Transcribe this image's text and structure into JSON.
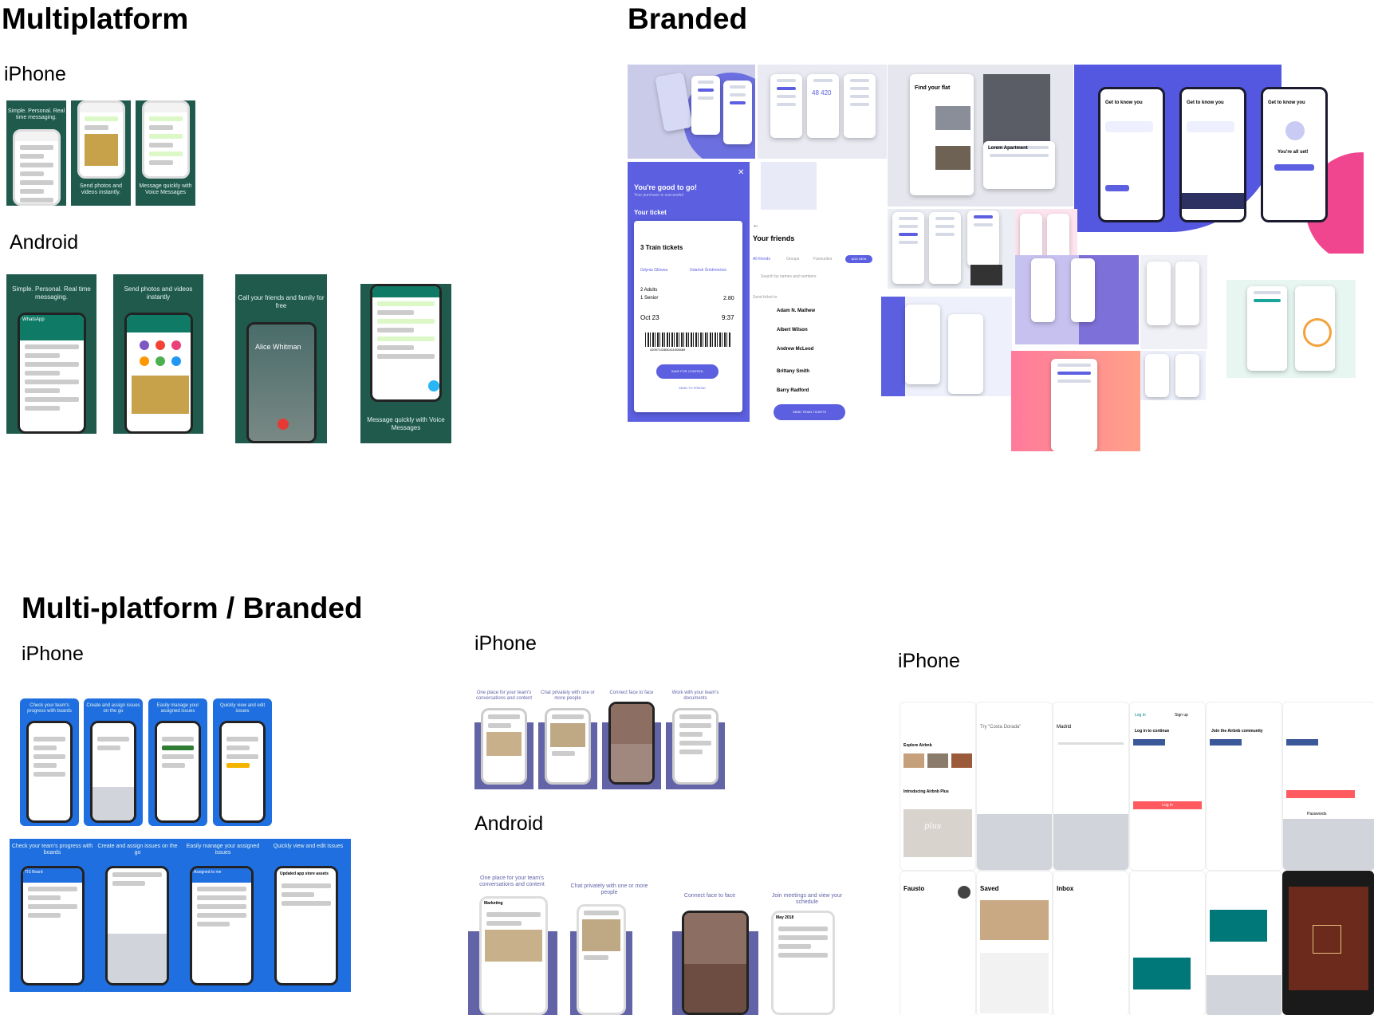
{
  "sections": {
    "multiplatform": {
      "title": "Multiplatform",
      "iphone_label": "iPhone",
      "android_label": "Android",
      "iphone_captions": [
        "Simple. Personal. Real time messaging.",
        "Send photos and videos instantly.",
        "Message quickly with Voice Messages"
      ],
      "android_captions": [
        "Simple. Personal. Real time messaging.",
        "Send photos and videos instantly",
        "Call your friends and family for free",
        "Message quickly with Voice Messages"
      ],
      "android_call_name": "Alice Whitman",
      "android_chat_header": "WhatsApp"
    },
    "branded": {
      "title": "Branded",
      "ticket": {
        "headline": "You're good to go!",
        "sub": "Your purchase is successful",
        "your_ticket": "Your ticket",
        "count": "3 Train tickets",
        "from": "Gdynia Główna",
        "to": "Gdańsk Śródmieście",
        "adults": "2 Adults",
        "senior": "1 Senior",
        "price": "2.80",
        "date": "Oct 23",
        "time": "9:37",
        "barcode_number": "42097132830411905689",
        "save_button": "SAVE FOR CONTROL",
        "send_link": "SEND TO FRIEND"
      },
      "friends": {
        "title": "Your friends",
        "tabs": [
          "All friends",
          "Groups",
          "Favourites"
        ],
        "add_button": "ADD NEW",
        "search_placeholder": "Search by names and numbers",
        "send_ticket_to": "Send ticket to",
        "names": [
          "Adam N. Mathew",
          "Albert Wilson",
          "Andrew McLeod",
          "Brittany Smith",
          "Barry Radford"
        ],
        "send_button": "SEND TRAIN TICKETS"
      },
      "flat": {
        "title": "Find your flat",
        "apartment": "Lorem Apartment"
      },
      "onboarding": {
        "title": "Get to know you",
        "done": "You're all set!"
      }
    },
    "multi_branded": {
      "title": "Multi-platform / Branded",
      "iphone_label_1": "iPhone",
      "iphone_label_2": "iPhone",
      "android_label": "Android",
      "iphone_iphone1_captions": [
        "Check your team's progress with boards",
        "Create and assign issues on the go",
        "Easily manage your assigned issues",
        "Quickly view and edit issues"
      ],
      "android1_captions": [
        "Check your team's progress with boards",
        "Create and assign issues on the go",
        "Easily manage your assigned issues",
        "Quickly view and edit issues"
      ],
      "android1_screen_titles": [
        "TIS Board",
        "Assigned to me",
        "Updated app store assets"
      ],
      "teams_captions": [
        "One place for your team's conversations and content",
        "Chat privately with one or more people",
        "Connect face to face",
        "Work with your team's documents"
      ],
      "teams_android_captions": [
        "One place for your team's conversations and content",
        "Chat privately with one or more people",
        "Connect face to face",
        "Join meetings and view your schedule"
      ],
      "teams_android_titles": [
        "Marketing",
        "May 2018"
      ],
      "airbnb": {
        "search_placeholder": "Try \"Costa Dorada\"",
        "city": "Madrid",
        "explore": "Explore Airbnb",
        "introducing": "Introducing Airbnb Plus",
        "plus_logo": "plus",
        "login_title": "Log in to continue",
        "join_title": "Join the Airbnb community",
        "tabs": [
          "Log in",
          "Sign up"
        ],
        "profile_name": "Fausto",
        "saved": "Saved",
        "inbox": "Inbox",
        "login_button": "Log in",
        "passwords": "Passwords"
      }
    }
  },
  "colors": {
    "whatsapp_green": "#1f5a4d",
    "whatsapp_header": "#0f7b66",
    "branded_purple": "#5b5fe0",
    "jira_blue": "#1f6fe0",
    "teams_purple": "#6264a7",
    "airbnb_red": "#ff5a5f",
    "pink": "#f0468f"
  }
}
